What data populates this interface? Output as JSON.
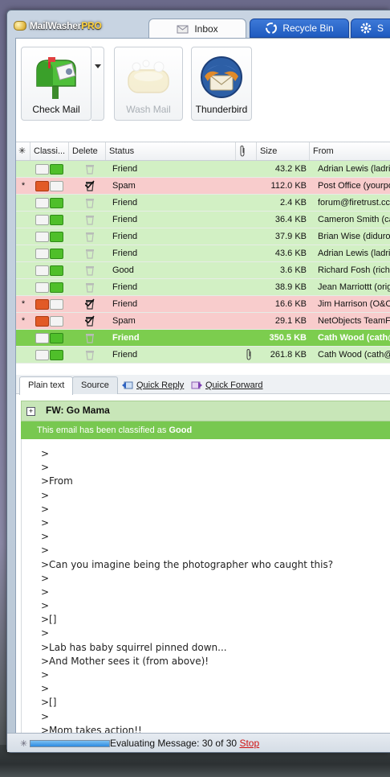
{
  "app": {
    "name_main": "MailWasher",
    "name_pro": "PRO"
  },
  "tabs": [
    {
      "label": "Inbox",
      "icon": "envelope-icon",
      "active": true
    },
    {
      "label": "Recycle Bin",
      "icon": "recycle-icon",
      "active": false
    },
    {
      "label": "S",
      "icon": "gear-icon",
      "active": false
    }
  ],
  "toolbar": {
    "check_mail": "Check Mail",
    "wash_mail": "Wash Mail",
    "thunderbird": "Thunderbird"
  },
  "grid": {
    "columns": [
      "Classi...",
      "Delete",
      "Status",
      "Size",
      "From"
    ],
    "rows": [
      {
        "star": "",
        "classification": "neutral",
        "delete_marked": false,
        "status": "Friend",
        "attachment": false,
        "size": "43.2 KB",
        "from": "Adrian Lewis (ladri",
        "tone": "friend"
      },
      {
        "star": "*",
        "classification": "spam",
        "delete_marked": true,
        "status": "Spam",
        "attachment": false,
        "size": "112.0 KB",
        "from": "Post Office (yourpo",
        "tone": "spam"
      },
      {
        "star": "",
        "classification": "neutral",
        "delete_marked": false,
        "status": "Friend",
        "attachment": false,
        "size": "2.4 KB",
        "from": "forum@firetrust.cc",
        "tone": "friend"
      },
      {
        "star": "",
        "classification": "neutral",
        "delete_marked": false,
        "status": "Friend",
        "attachment": false,
        "size": "36.4 KB",
        "from": "Cameron Smith (cai",
        "tone": "friend"
      },
      {
        "star": "",
        "classification": "neutral",
        "delete_marked": false,
        "status": "Friend",
        "attachment": false,
        "size": "37.9 KB",
        "from": "Brian Wise (diduro",
        "tone": "friend"
      },
      {
        "star": "",
        "classification": "neutral",
        "delete_marked": false,
        "status": "Friend",
        "attachment": false,
        "size": "43.6 KB",
        "from": "Adrian Lewis (ladri",
        "tone": "friend"
      },
      {
        "star": "",
        "classification": "neutral",
        "delete_marked": false,
        "status": "Good",
        "attachment": false,
        "size": "3.6 KB",
        "from": "Richard Fosh (rich@",
        "tone": "friend"
      },
      {
        "star": "",
        "classification": "neutral",
        "delete_marked": false,
        "status": "Friend",
        "attachment": false,
        "size": "38.9 KB",
        "from": "Jean Marriottt (orig",
        "tone": "friend"
      },
      {
        "star": "*",
        "classification": "spam",
        "delete_marked": true,
        "status": "Friend",
        "attachment": false,
        "size": "16.6 KB",
        "from": "Jim Harrison (O&O",
        "tone": "spam"
      },
      {
        "star": "*",
        "classification": "spam",
        "delete_marked": true,
        "status": "Spam",
        "attachment": false,
        "size": "29.1 KB",
        "from": "NetObjects TeamFu",
        "tone": "spam"
      },
      {
        "star": "",
        "classification": "neutral",
        "delete_marked": false,
        "status": "Friend",
        "attachment": false,
        "size": "350.5 KB",
        "from": "Cath Wood (cath@",
        "tone": "selected"
      },
      {
        "star": "",
        "classification": "neutral",
        "delete_marked": false,
        "status": "Friend",
        "attachment": true,
        "size": "261.8 KB",
        "from": "Cath Wood (cath@",
        "tone": "friend"
      }
    ]
  },
  "reader": {
    "tab_plain": "Plain text",
    "tab_source": "Source",
    "quick_reply": "Quick Reply",
    "quick_forward": "Quick Forward",
    "expander": "+",
    "subject": "FW: Go Mama",
    "classification_prefix": "This email has been classified as",
    "classification_value": "Good",
    "body_lines": [
      ">",
      ">",
      ">From",
      ">",
      ">",
      ">",
      ">",
      ">",
      ">Can you imagine being the photographer who caught this?",
      ">",
      ">",
      ">",
      ">[]",
      ">",
      ">Lab has baby squirrel pinned down...",
      ">And Mother sees it (from above)!",
      ">",
      ">",
      ">[]",
      ">",
      ">Mom takes action!!"
    ]
  },
  "status": {
    "progress": 1.0,
    "text": "Evaluating Message: 30 of 30",
    "stop": "Stop"
  },
  "colors": {
    "friend_row": "#d2f0c4",
    "spam_row": "#f8cccc",
    "selected_row": "#7ccd4e",
    "class_banner": "#78c850",
    "tab_blue": "#2a66c8"
  }
}
